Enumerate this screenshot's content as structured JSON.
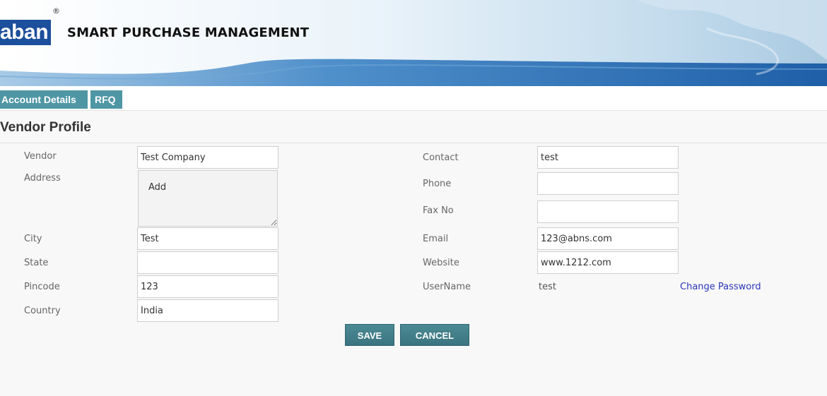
{
  "header": {
    "logo_text": "aban",
    "registered_mark": "®",
    "app_title": "SMART PURCHASE MANAGEMENT"
  },
  "menu": {
    "tabs": [
      {
        "label": "Account Details"
      },
      {
        "label": "RFQ"
      }
    ]
  },
  "page": {
    "title": "Vendor Profile"
  },
  "form": {
    "left": {
      "vendor": {
        "label": "Vendor",
        "value": "Test Company"
      },
      "address": {
        "label": "Address",
        "value": "Add"
      },
      "city": {
        "label": "City",
        "value": "Test"
      },
      "state": {
        "label": "State",
        "value": ""
      },
      "pincode": {
        "label": "Pincode",
        "value": "123"
      },
      "country": {
        "label": "Country",
        "value": "India"
      }
    },
    "right": {
      "contact": {
        "label": "Contact",
        "value": "test"
      },
      "phone": {
        "label": "Phone",
        "value": ""
      },
      "fax": {
        "label": "Fax No",
        "value": ""
      },
      "email": {
        "label": "Email",
        "value": "123@abns.com"
      },
      "website": {
        "label": "Website",
        "value": "www.1212.com"
      },
      "username": {
        "label": "UserName",
        "value": "test"
      },
      "change_password": "Change Password"
    },
    "save_label": "SAVE",
    "cancel_label": "CANCEL"
  },
  "colors": {
    "brand_blue": "#1c4f9c",
    "tab_teal": "#4f96a5",
    "button_teal": "#3f7d88",
    "link_blue": "#2a36b8"
  }
}
